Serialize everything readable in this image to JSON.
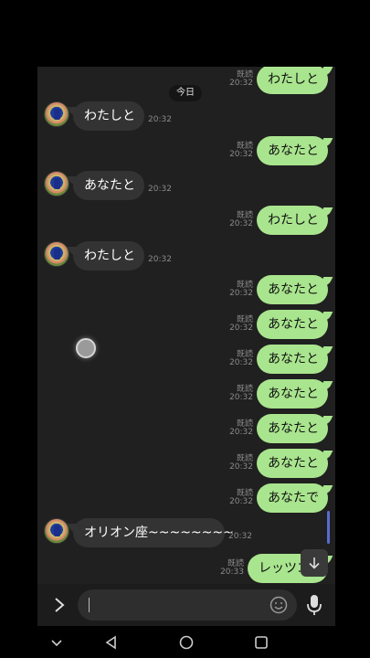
{
  "date_separator": "今日",
  "messages": [
    {
      "dir": "sent",
      "text": "わたしと",
      "time": "20:32",
      "read": "既読"
    },
    {
      "dir": "recv",
      "text": "わたしと",
      "time": "20:32"
    },
    {
      "dir": "sent",
      "text": "あなたと",
      "time": "20:32",
      "read": "既読"
    },
    {
      "dir": "recv",
      "text": "あなたと",
      "time": "20:32"
    },
    {
      "dir": "sent",
      "text": "わたしと",
      "time": "20:32",
      "read": "既読"
    },
    {
      "dir": "recv",
      "text": "わたしと",
      "time": "20:32"
    },
    {
      "dir": "sent",
      "text": "あなたと",
      "time": "20:32",
      "read": "既読"
    },
    {
      "dir": "sent",
      "text": "あなたと",
      "time": "20:32",
      "read": "既読"
    },
    {
      "dir": "sent",
      "text": "あなたと",
      "time": "20:32",
      "read": "既読"
    },
    {
      "dir": "sent",
      "text": "あなたと",
      "time": "20:32",
      "read": "既読"
    },
    {
      "dir": "sent",
      "text": "あなたと",
      "time": "20:32",
      "read": "既読"
    },
    {
      "dir": "sent",
      "text": "あなたと",
      "time": "20:32",
      "read": "既読"
    },
    {
      "dir": "sent",
      "text": "あなたで",
      "time": "20:32",
      "read": "既読"
    },
    {
      "dir": "recv",
      "text": "オリオン座~~~~~~~~",
      "time": "20:32"
    },
    {
      "dir": "sent",
      "text": "レッツゴー",
      "time": "20:33",
      "read": "既読"
    }
  ],
  "input": {
    "value": "",
    "placeholder": ""
  },
  "icons": {
    "expand": "chevron-right-icon",
    "emoji": "smiley-icon",
    "mic": "microphone-icon",
    "scroll": "arrow-down-icon",
    "nav_down": "chevron-down-icon",
    "nav_back": "back-triangle-icon",
    "nav_home": "home-circle-icon",
    "nav_recents": "recents-square-icon"
  },
  "colors": {
    "sent_bubble": "#a9e58e",
    "recv_bubble": "#333333",
    "background": "#202020"
  }
}
